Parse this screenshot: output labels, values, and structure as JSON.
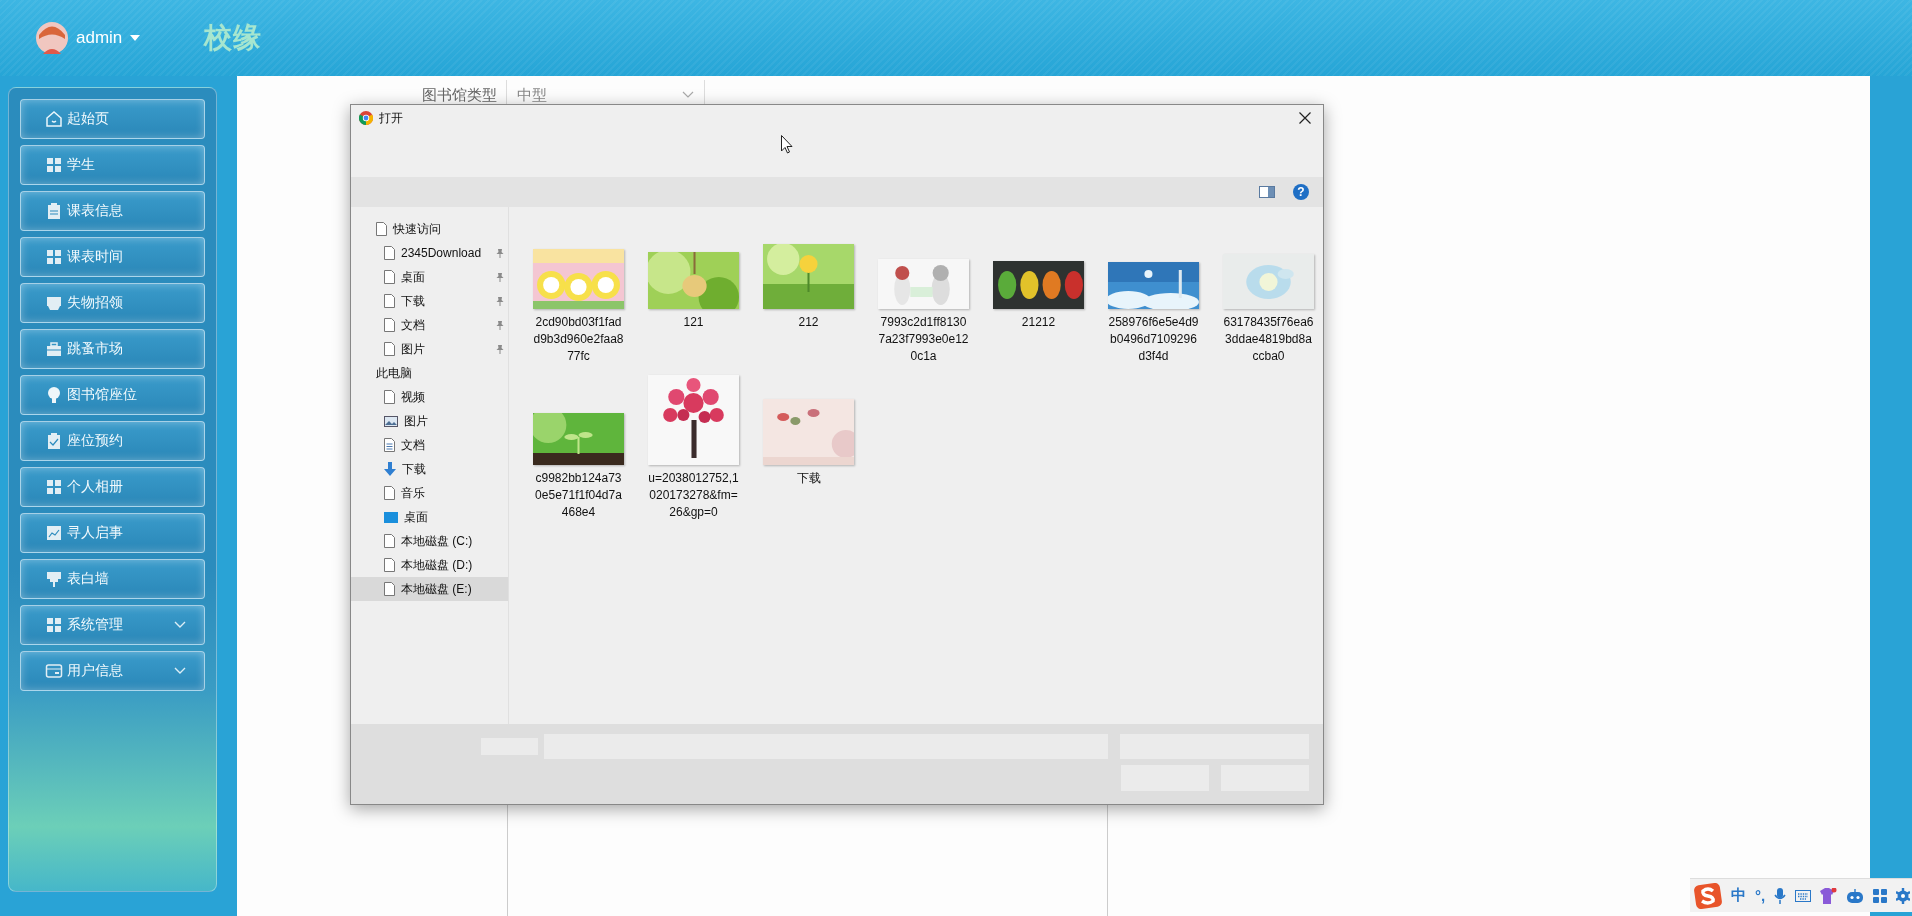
{
  "header": {
    "user": "admin",
    "brand": "校缘"
  },
  "sidebar": {
    "items": [
      {
        "label": "起始页",
        "expandable": false
      },
      {
        "label": "学生",
        "expandable": false
      },
      {
        "label": "课表信息",
        "expandable": false
      },
      {
        "label": "课表时间",
        "expandable": false
      },
      {
        "label": "失物招领",
        "expandable": false
      },
      {
        "label": "跳蚤市场",
        "expandable": false
      },
      {
        "label": "图书馆座位",
        "expandable": false
      },
      {
        "label": "座位预约",
        "expandable": false
      },
      {
        "label": "个人相册",
        "expandable": false
      },
      {
        "label": "寻人启事",
        "expandable": false
      },
      {
        "label": "表白墙",
        "expandable": false
      },
      {
        "label": "系统管理",
        "expandable": true
      },
      {
        "label": "用户信息",
        "expandable": true
      }
    ]
  },
  "form": {
    "label": "图书馆类型",
    "value": "中型"
  },
  "dialog": {
    "title": "打开",
    "help": "?",
    "nav": [
      {
        "label": "快速访问",
        "kind": "group",
        "pinned": false,
        "selected": false
      },
      {
        "label": "2345Download",
        "kind": "folder",
        "pinned": true,
        "selected": false
      },
      {
        "label": "桌面",
        "kind": "folder",
        "pinned": true,
        "selected": false
      },
      {
        "label": "下载",
        "kind": "folder",
        "pinned": true,
        "selected": false
      },
      {
        "label": "文档",
        "kind": "folder",
        "pinned": true,
        "selected": false
      },
      {
        "label": "图片",
        "kind": "folder",
        "pinned": true,
        "selected": false
      },
      {
        "label": "此电脑",
        "kind": "heading",
        "pinned": false,
        "selected": false
      },
      {
        "label": "视频",
        "kind": "folder",
        "pinned": false,
        "selected": false
      },
      {
        "label": "图片",
        "kind": "pictures",
        "pinned": false,
        "selected": false
      },
      {
        "label": "文档",
        "kind": "documents",
        "pinned": false,
        "selected": false
      },
      {
        "label": "下载",
        "kind": "downloads",
        "pinned": false,
        "selected": false
      },
      {
        "label": "音乐",
        "kind": "folder",
        "pinned": false,
        "selected": false
      },
      {
        "label": "桌面",
        "kind": "desktop",
        "pinned": false,
        "selected": false
      },
      {
        "label": "本地磁盘 (C:)",
        "kind": "folder",
        "pinned": false,
        "selected": false
      },
      {
        "label": "本地磁盘 (D:)",
        "kind": "folder",
        "pinned": false,
        "selected": false
      },
      {
        "label": "本地磁盘 (E:)",
        "kind": "folder",
        "pinned": false,
        "selected": true
      }
    ],
    "files": [
      {
        "name": "2cd90bd03f1fadd9b3d960e2faa877fc",
        "kind": "picture"
      },
      {
        "name": "121",
        "kind": "picture"
      },
      {
        "name": "212",
        "kind": "picture"
      },
      {
        "name": "7993c2d1ff81307a23f7993e0e120c1a",
        "kind": "picture"
      },
      {
        "name": "21212",
        "kind": "picture"
      },
      {
        "name": "258976f6e5e4d9b0496d7109296d3f4d",
        "kind": "picture"
      },
      {
        "name": "63178435f76ea63ddae4819bd8accba0",
        "kind": "picture"
      },
      {
        "name": "c9982bb124a730e5e71f1f04d7a468e4",
        "kind": "picture"
      },
      {
        "name": "u=2038012752,1020173278&fm=26&gp=0",
        "kind": "picture"
      },
      {
        "name": "下载",
        "kind": "picture"
      }
    ]
  },
  "ime": {
    "language": "中",
    "punctuation": "°,"
  }
}
